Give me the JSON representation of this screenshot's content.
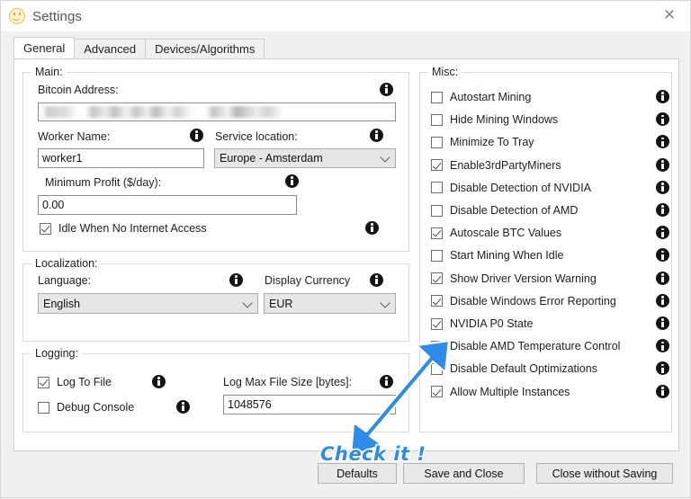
{
  "window": {
    "title": "Settings",
    "app_icon": "smiley-face-icon",
    "close_label": "✕"
  },
  "tabs": [
    {
      "label": "General",
      "active": true
    },
    {
      "label": "Advanced",
      "active": false
    },
    {
      "label": "Devices/Algorithms",
      "active": false
    }
  ],
  "main_group": {
    "legend": "Main:",
    "bitcoin_address_label": "Bitcoin Address:",
    "bitcoin_address_value": "",
    "worker_name_label": "Worker Name:",
    "worker_name_value": "worker1",
    "service_location_label": "Service location:",
    "service_location_value": "Europe - Amsterdam",
    "minimum_profit_label": "Minimum Profit ($/day):",
    "minimum_profit_value": "0.00",
    "idle_checkbox_label": "Idle When No Internet Access",
    "idle_checkbox_checked": true
  },
  "localization_group": {
    "legend": "Localization:",
    "language_label": "Language:",
    "language_value": "English",
    "currency_label": "Display Currency",
    "currency_value": "EUR"
  },
  "logging_group": {
    "legend": "Logging:",
    "log_to_file_label": "Log To File",
    "log_to_file_checked": true,
    "debug_console_label": "Debug Console",
    "debug_console_checked": false,
    "log_max_size_label": "Log Max File Size [bytes]:",
    "log_max_size_value": "1048576"
  },
  "misc_group": {
    "legend": "Misc:",
    "items": [
      {
        "label": "Autostart Mining",
        "checked": false
      },
      {
        "label": "Hide Mining Windows",
        "checked": false
      },
      {
        "label": "Minimize To Tray",
        "checked": false
      },
      {
        "label": "Enable3rdPartyMiners",
        "checked": true
      },
      {
        "label": "Disable Detection of NVIDIA",
        "checked": false
      },
      {
        "label": "Disable Detection of AMD",
        "checked": false
      },
      {
        "label": "Autoscale BTC Values",
        "checked": true
      },
      {
        "label": "Start Mining When Idle",
        "checked": false
      },
      {
        "label": "Show Driver Version Warning",
        "checked": true
      },
      {
        "label": "Disable Windows Error Reporting",
        "checked": true
      },
      {
        "label": "NVIDIA P0 State",
        "checked": true
      },
      {
        "label": "Disable AMD Temperature Control",
        "checked": true
      },
      {
        "label": "Disable Default Optimizations",
        "checked": false
      },
      {
        "label": "Allow Multiple Instances",
        "checked": true
      }
    ]
  },
  "footer": {
    "defaults_label": "Defaults",
    "save_label": "Save and Close",
    "close_label": "Close without Saving"
  },
  "annotation": {
    "text": "Check it !",
    "color": "#2e8ce8",
    "arrow": "up-right-arrow-icon"
  }
}
